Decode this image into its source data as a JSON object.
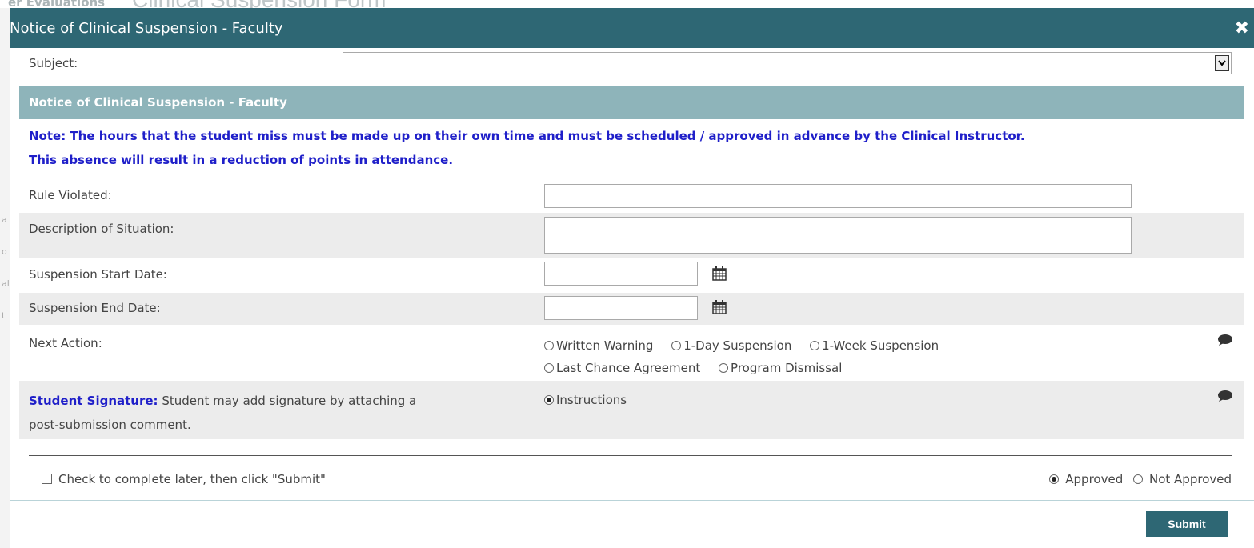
{
  "background": {
    "title": "er Evaluations",
    "big_title": "Clinical Suspension Form"
  },
  "dialog": {
    "title": "Notice of Clinical Suspension - Faculty",
    "close_glyph": "✖"
  },
  "subject": {
    "label": "Subject:",
    "value": "",
    "dropdown_glyph": "▾"
  },
  "section": {
    "header": "Notice of Clinical Suspension - Faculty",
    "note_line1": "Note: The hours that the student miss must be made up on their own time and must be scheduled / approved in advance by the Clinical Instructor.",
    "note_line2": "This absence will result in a reduction of points in attendance."
  },
  "fields": {
    "rule_violated": {
      "label": "Rule Violated:",
      "value": ""
    },
    "description": {
      "label": "Description of Situation:",
      "value": ""
    },
    "start_date": {
      "label": "Suspension Start Date:",
      "value": ""
    },
    "end_date": {
      "label": "Suspension End Date:",
      "value": ""
    }
  },
  "next_action": {
    "label": "Next Action:",
    "options": [
      "Written Warning",
      "1-Day Suspension",
      "1-Week Suspension",
      "Last Chance Agreement",
      "Program Dismissal"
    ]
  },
  "student_signature": {
    "label_bold": "Student Signature:",
    "label_rest": " Student may add signature by attaching a",
    "label_line2": "post-submission comment.",
    "option": "Instructions"
  },
  "footer": {
    "complete_later": "Check to complete later, then click \"Submit\"",
    "approved": "Approved",
    "not_approved": "Not Approved",
    "submit": "Submit"
  },
  "colors": {
    "title_bar": "#2e6774",
    "section_header": "#8eb4ba",
    "note_text": "#1f1fc9"
  }
}
